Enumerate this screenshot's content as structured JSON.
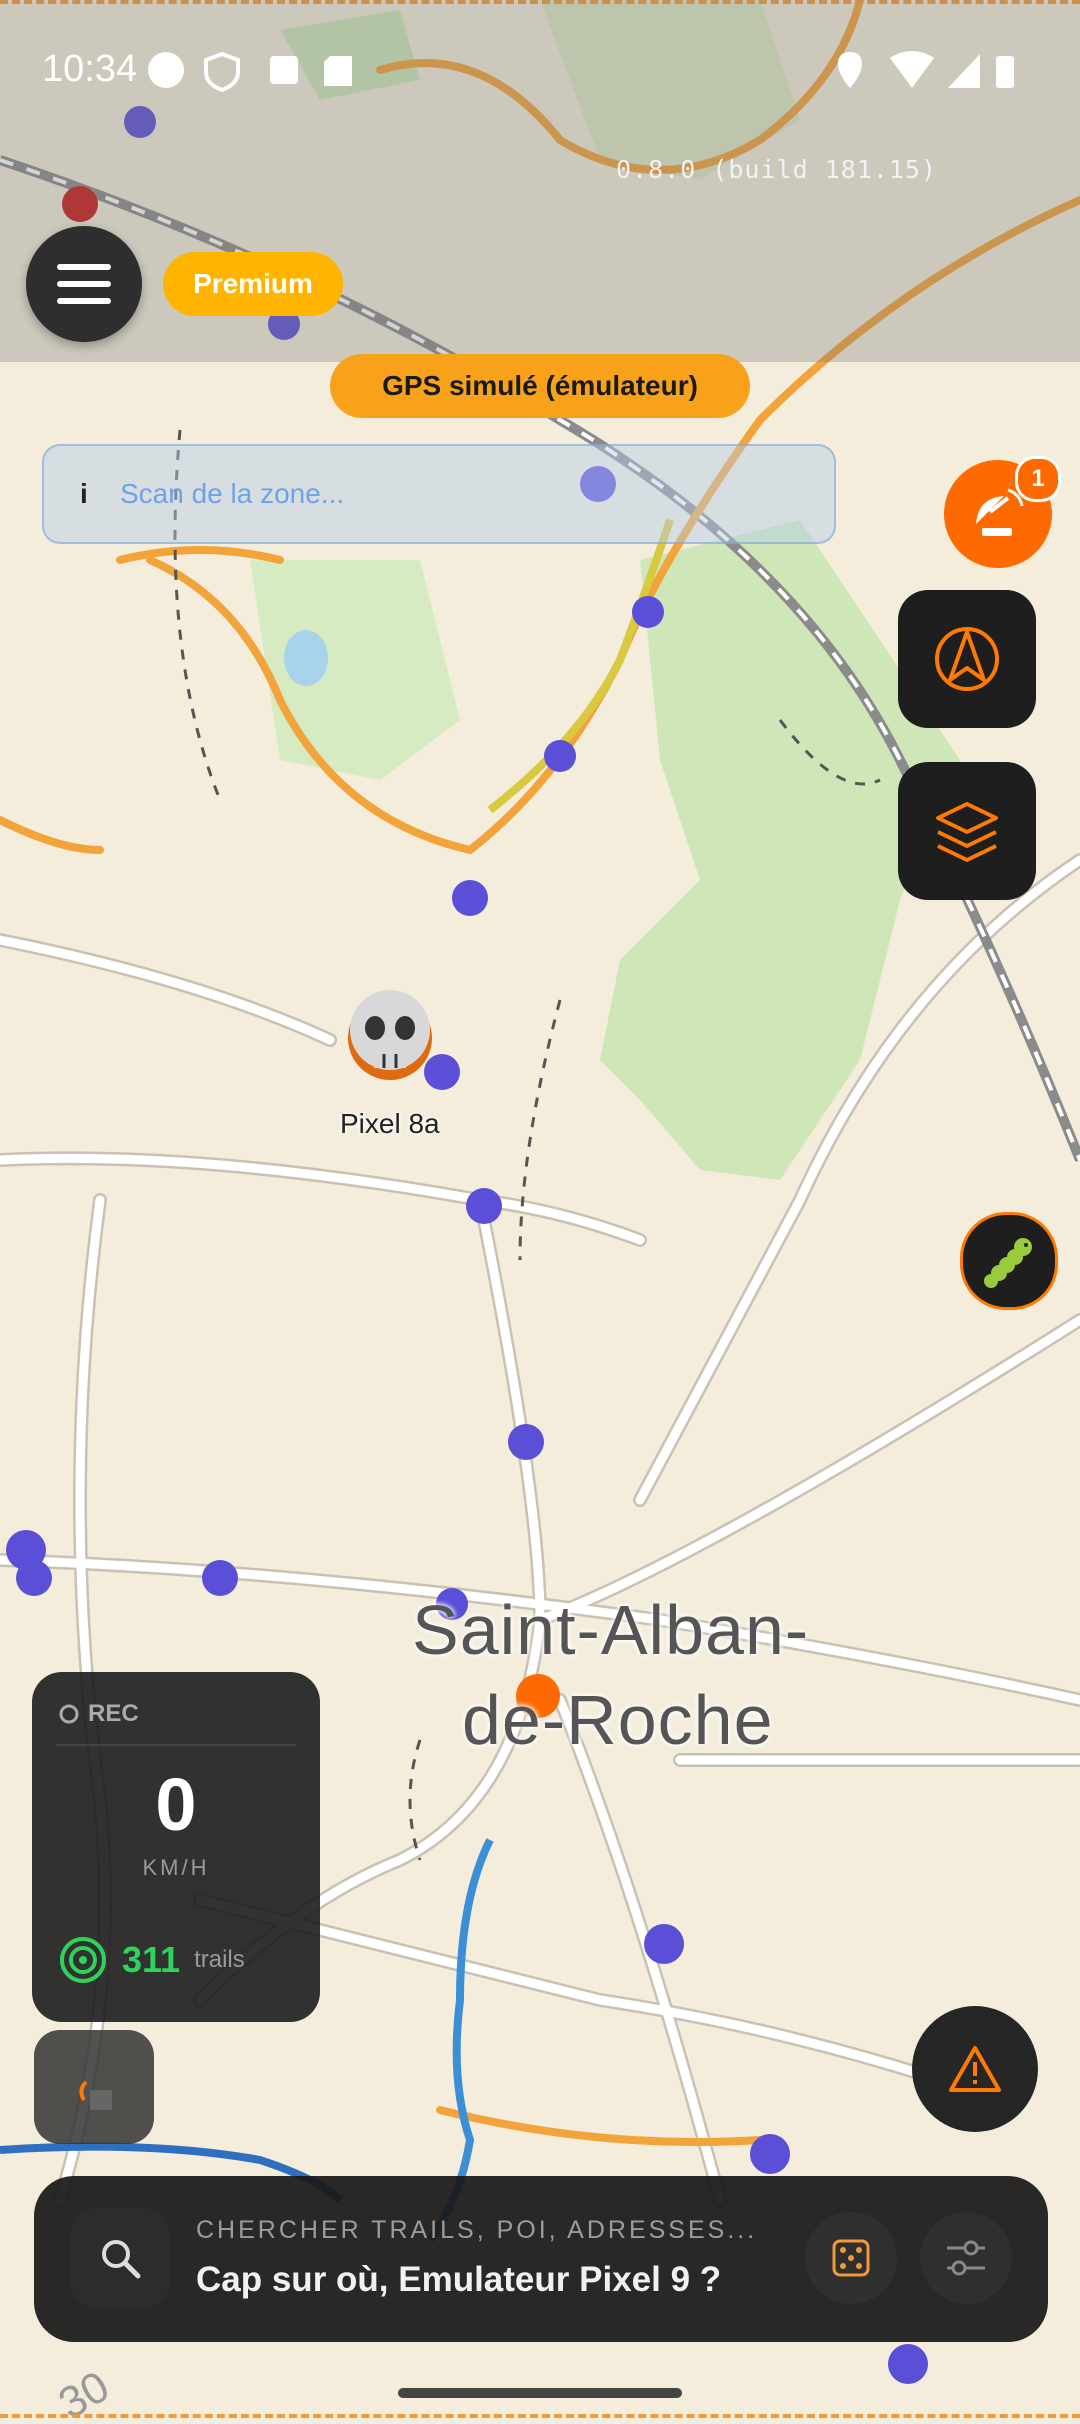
{
  "status_bar": {
    "time": "10:34"
  },
  "version": "0.8.0 (build 181.15)",
  "top": {
    "premium_label": "Premium",
    "gps_label": "GPS simulé (émulateur)"
  },
  "scan": {
    "icon_text": "i",
    "text": "Scan de la zone..."
  },
  "radar": {
    "badge_count": "1"
  },
  "map": {
    "device_label": "Pixel 8a",
    "city_line1": "Saint-Alban-",
    "city_line2": "de-Roche"
  },
  "recorder": {
    "rec_label": "REC",
    "speed": "0",
    "unit": "KM/H",
    "trails_count": "311",
    "trails_label": "trails"
  },
  "search": {
    "hint": "CHERCHER TRAILS, POI, ADRESSES...",
    "title": "Cap sur où, Emulateur Pixel 9 ?"
  },
  "colors": {
    "accent": "#ff6a00",
    "premium": "#ffb400",
    "gps_pill": "#f7a21a",
    "trails_green": "#2dd35a",
    "dark_panel": "#1e1e1e"
  }
}
